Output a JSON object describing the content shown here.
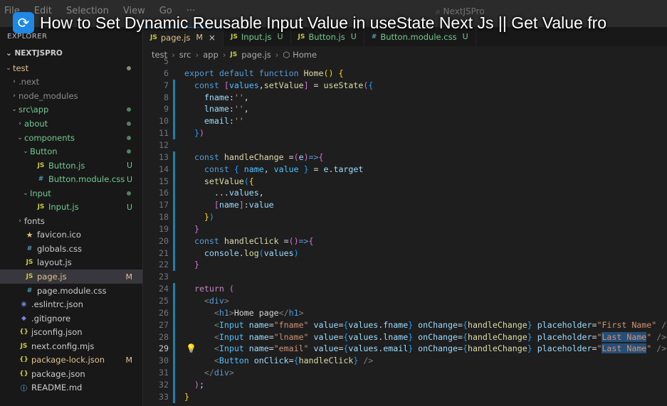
{
  "menu": [
    "File",
    "Edit",
    "Selection",
    "View",
    "Go",
    "···"
  ],
  "search_text": "NextJSPro",
  "video_title": "How to Set Dynamic Reusable Input Value in useState Next Js || Get Value fro",
  "explorer": {
    "label": "EXPLORER",
    "project": "NEXTJSPRO"
  },
  "tree": [
    {
      "name": "test",
      "chev": "v",
      "indent": 0,
      "icon": "",
      "badge": "dot",
      "color": "#e2c08d"
    },
    {
      "name": ".next",
      "chev": ">",
      "indent": 1,
      "icon": "",
      "badge": "",
      "color": "#8c8c8c"
    },
    {
      "name": "node_modules",
      "chev": ">",
      "indent": 1,
      "icon": "",
      "badge": "",
      "color": "#8c8c8c"
    },
    {
      "name": "src\\app",
      "chev": "v",
      "indent": 1,
      "icon": "",
      "badge": "dotg",
      "color": "#73c991"
    },
    {
      "name": "about",
      "chev": ">",
      "indent": 2,
      "icon": "",
      "badge": "dotg",
      "color": "#73c991"
    },
    {
      "name": "components",
      "chev": "v",
      "indent": 2,
      "icon": "",
      "badge": "dotg",
      "color": "#73c991"
    },
    {
      "name": "Button",
      "chev": "v",
      "indent": 3,
      "icon": "",
      "badge": "dotg",
      "color": "#73c991"
    },
    {
      "name": "Button.js",
      "chev": "",
      "indent": 4,
      "icon": "JS",
      "badge": "U",
      "color": "#73c991"
    },
    {
      "name": "Button.module.css",
      "chev": "",
      "indent": 4,
      "icon": "#",
      "badge": "U",
      "color": "#73c991"
    },
    {
      "name": "Input",
      "chev": "v",
      "indent": 3,
      "icon": "",
      "badge": "dotg",
      "color": "#73c991"
    },
    {
      "name": "Input.js",
      "chev": "",
      "indent": 4,
      "icon": "JS",
      "badge": "U",
      "color": "#73c991"
    },
    {
      "name": "fonts",
      "chev": ">",
      "indent": 2,
      "icon": "",
      "badge": "",
      "color": "#cccccc"
    },
    {
      "name": "favicon.ico",
      "chev": "",
      "indent": 2,
      "icon": "★",
      "badge": "",
      "color": "#cccccc"
    },
    {
      "name": "globals.css",
      "chev": "",
      "indent": 2,
      "icon": "#",
      "badge": "",
      "color": "#cccccc"
    },
    {
      "name": "layout.js",
      "chev": "",
      "indent": 2,
      "icon": "JS",
      "badge": "",
      "color": "#cccccc"
    },
    {
      "name": "page.js",
      "chev": "",
      "indent": 2,
      "icon": "JS",
      "badge": "M",
      "color": "#e2c08d",
      "active": true
    },
    {
      "name": "page.module.css",
      "chev": "",
      "indent": 2,
      "icon": "#",
      "badge": "",
      "color": "#cccccc"
    },
    {
      "name": ".eslintrc.json",
      "chev": "",
      "indent": 1,
      "icon": "◉",
      "badge": "",
      "color": "#cccccc"
    },
    {
      "name": ".gitignore",
      "chev": "",
      "indent": 1,
      "icon": "◆",
      "badge": "",
      "color": "#cccccc"
    },
    {
      "name": "jsconfig.json",
      "chev": "",
      "indent": 1,
      "icon": "{}",
      "badge": "",
      "color": "#cccccc"
    },
    {
      "name": "next.config.mjs",
      "chev": "",
      "indent": 1,
      "icon": "JS",
      "badge": "",
      "color": "#cccccc"
    },
    {
      "name": "package-lock.json",
      "chev": "",
      "indent": 1,
      "icon": "{}",
      "badge": "M",
      "color": "#e2c08d"
    },
    {
      "name": "package.json",
      "chev": "",
      "indent": 1,
      "icon": "{}",
      "badge": "",
      "color": "#cccccc"
    },
    {
      "name": "README.md",
      "chev": "",
      "indent": 1,
      "icon": "ⓘ",
      "badge": "",
      "color": "#cccccc"
    }
  ],
  "tabs": [
    {
      "label": "page.js",
      "status": "M",
      "icon": "JS",
      "active": true,
      "close": "×"
    },
    {
      "label": "Input.js",
      "status": "U",
      "icon": "JS",
      "active": false,
      "close": ""
    },
    {
      "label": "Button.js",
      "status": "U",
      "icon": "JS",
      "active": false,
      "close": ""
    },
    {
      "label": "Button.module.css",
      "status": "U",
      "icon": "#",
      "active": false,
      "close": ""
    }
  ],
  "breadcrumb": {
    "parts": [
      "test",
      "src",
      "app"
    ],
    "file": "page.js",
    "symbol": "Home"
  },
  "code": [
    {
      "n": "5",
      "html": ""
    },
    {
      "n": "6",
      "html": "<span class='k'>export</span> <span class='k'>default</span> <span class='k'>function</span> <span class='f'>Home</span><span class='b1'>()</span> <span class='b1'>{</span>"
    },
    {
      "n": "7",
      "html": "  <span class='k'>const</span> <span class='b2'>[</span><span class='c'>values</span>,<span class='f'>setValue</span><span class='b2'>]</span> = <span class='f'>useState</span><span class='b2'>(</span><span class='b3'>{</span>"
    },
    {
      "n": "8",
      "html": "    <span class='v'>fname</span>:<span class='s'>''</span>,"
    },
    {
      "n": "9",
      "html": "    <span class='v'>lname</span>:<span class='s'>''</span>,"
    },
    {
      "n": "10",
      "html": "    <span class='v'>email</span>:<span class='s'>''</span>"
    },
    {
      "n": "11",
      "html": "  <span class='b3'>}</span><span class='b2'>)</span>"
    },
    {
      "n": "12",
      "html": ""
    },
    {
      "n": "13",
      "html": "  <span class='k'>const</span> <span class='f'>handleChange</span> =<span class='b2'>(</span><span class='v'>e</span><span class='b2'>)</span><span class='k'>=&gt;</span><span class='b2'>{</span>"
    },
    {
      "n": "14",
      "html": "    <span class='k'>const</span> <span class='b3'>{</span> <span class='c'>name</span>, <span class='c'>value</span> <span class='b3'>}</span> = <span class='v'>e</span>.<span class='v'>target</span>"
    },
    {
      "n": "15",
      "html": "    <span class='f'>setValue</span><span class='b3'>(</span><span class='b1'>{</span>"
    },
    {
      "n": "16",
      "html": "      ...<span class='v'>values</span>,"
    },
    {
      "n": "17",
      "html": "      <span class='b2'>[</span><span class='v'>name</span><span class='b2'>]</span>:<span class='v'>value</span>"
    },
    {
      "n": "18",
      "html": "    <span class='b1'>}</span><span class='b3'>)</span>"
    },
    {
      "n": "19",
      "html": "  <span class='b2'>}</span>"
    },
    {
      "n": "20",
      "html": "  <span class='k'>const</span> <span class='f'>handleClick</span> =<span class='b2'>()</span><span class='k'>=&gt;</span><span class='b2'>{</span>"
    },
    {
      "n": "21",
      "html": "    <span class='v'>console</span>.<span class='f'>log</span><span class='b3'>(</span><span class='v'>values</span><span class='b3'>)</span>"
    },
    {
      "n": "22",
      "html": "  <span class='b2'>}</span>"
    },
    {
      "n": "23",
      "html": ""
    },
    {
      "n": "24",
      "html": "  <span class='kc'>return</span> <span class='b2'>(</span>"
    },
    {
      "n": "25",
      "html": "    <span class='g'>&lt;</span><span class='t'>div</span><span class='g'>&gt;</span>"
    },
    {
      "n": "26",
      "html": "      <span class='g'>&lt;</span><span class='t'>h1</span><span class='g'>&gt;</span>Home page<span class='g'>&lt;/</span><span class='t'>h1</span><span class='g'>&gt;</span>"
    },
    {
      "n": "27",
      "html": "      <span class='g'>&lt;</span><span class='c'>Input</span> <span class='a'>name</span>=<span class='s'>\"fname\"</span> <span class='a'>value</span>=<span class='b3'>{</span><span class='v'>values</span>.<span class='v'>fname</span><span class='b3'>}</span> <span class='a'>onChange</span>=<span class='b3'>{</span><span class='f'>handleChange</span><span class='b3'>}</span> <span class='a'>placeholder</span>=<span class='s'>\"First Name\"</span> <span class='g'>/&gt;</span>"
    },
    {
      "n": "28",
      "html": "      <span class='g'>&lt;</span><span class='c'>Input</span> <span class='a'>name</span>=<span class='s'>\"lname\"</span> <span class='a'>value</span>=<span class='b3'>{</span><span class='v'>values</span>.<span class='v'>lname</span><span class='b3'>}</span> <span class='a'>onChange</span>=<span class='b3'>{</span><span class='f'>handleChange</span><span class='b3'>}</span> <span class='a'>placeholder</span>=<span class='s'>\"</span><span class='s sel'>Last Name</span><span class='s'>\"</span> <span class='g'>/&gt;</span>"
    },
    {
      "n": "29",
      "html": "      <span class='g'>&lt;</span><span class='c'>Input</span> <span class='a'>name</span>=<span class='s'>\"email\"</span> <span class='a'>value</span>=<span class='b3'>{</span><span class='v'>values</span>.<span class='v'>email</span><span class='b3'>}</span> <span class='a'>onChange</span>=<span class='b3'>{</span><span class='f'>handleChange</span><span class='b3'>}</span> <span class='a'>placeholder</span>=<span class='s'>\"</span><span class='s sel'>Last Name</span><span class='s'>\"</span> <span class='g'>/&gt;</span>",
      "current": true
    },
    {
      "n": "30",
      "html": "      <span class='g'>&lt;</span><span class='c'>Button</span> <span class='a'>onClick</span>=<span class='b3'>{</span><span class='f'>handleClick</span><span class='b3'>}</span> <span class='g'>/&gt;</span>"
    },
    {
      "n": "31",
      "html": "    <span class='g'>&lt;/</span><span class='t'>div</span><span class='g'>&gt;</span>"
    },
    {
      "n": "32",
      "html": "  <span class='b2'>)</span>;"
    },
    {
      "n": "33",
      "html": "<span class='b1'>}</span>"
    }
  ],
  "colors": {
    "accent": "#0078d4",
    "modified": "#e2c08d",
    "untracked": "#73c991"
  }
}
